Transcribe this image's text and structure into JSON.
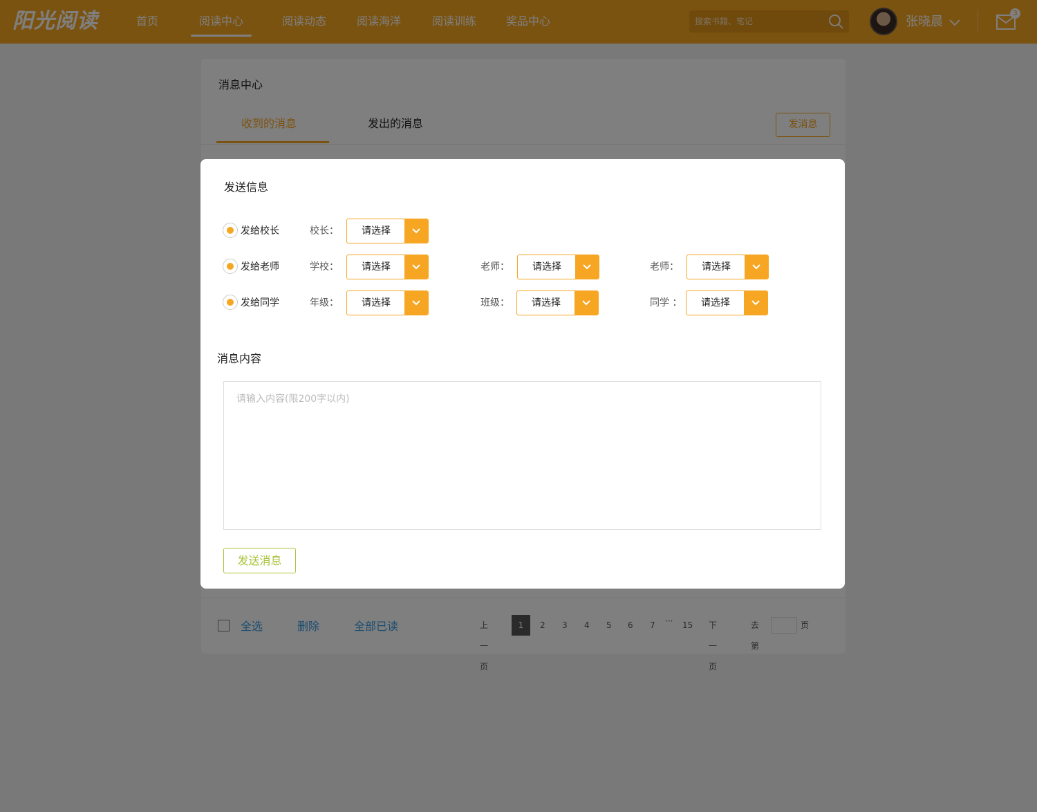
{
  "header": {
    "logo": "阳光阅读",
    "nav": [
      "首页",
      "阅读中心",
      "阅读动态",
      "阅读海洋",
      "阅读训练",
      "奖品中心"
    ],
    "active_nav": "阅读中心",
    "search_placeholder": "搜索书籍、笔记",
    "username": "张晓晨",
    "mail_count": "3"
  },
  "messages": {
    "title": "消息中心",
    "tabs": [
      "收到的消息",
      "发出的消息"
    ],
    "active_tab": "收到的消息",
    "compose_label": "发消息",
    "footer": {
      "select_all": "全选",
      "delete": "删除",
      "mark_all_read": "全部已读"
    },
    "pagination": {
      "prev": "上一页",
      "pages": [
        "1",
        "2",
        "3",
        "4",
        "5",
        "6",
        "7"
      ],
      "ellipsis": "···",
      "last": "15",
      "current": "1",
      "next": "下一页",
      "goto_prefix": "去第",
      "goto_suffix": "页"
    }
  },
  "modal": {
    "title": "发送信息",
    "rows": [
      {
        "radio_label": "发给校长",
        "fields": [
          {
            "label": "校长：",
            "value": "请选择"
          }
        ]
      },
      {
        "radio_label": "发给老师",
        "fields": [
          {
            "label": "学校：",
            "value": "请选择"
          },
          {
            "label": "老师：",
            "value": "请选择"
          },
          {
            "label": "老师：",
            "value": "请选择"
          }
        ]
      },
      {
        "radio_label": "发给同学",
        "fields": [
          {
            "label": "年级：",
            "value": "请选择"
          },
          {
            "label": "班级：",
            "value": "请选择"
          },
          {
            "label": "同学 ：",
            "value": "请选择"
          }
        ]
      }
    ],
    "content_label": "消息内容",
    "content_placeholder": "请输入内容(限200字以内)",
    "send_label": "发送消息"
  },
  "colors": {
    "brand": "#f6a623",
    "link": "#3b9ae1",
    "send_button": "#a8c23a"
  }
}
